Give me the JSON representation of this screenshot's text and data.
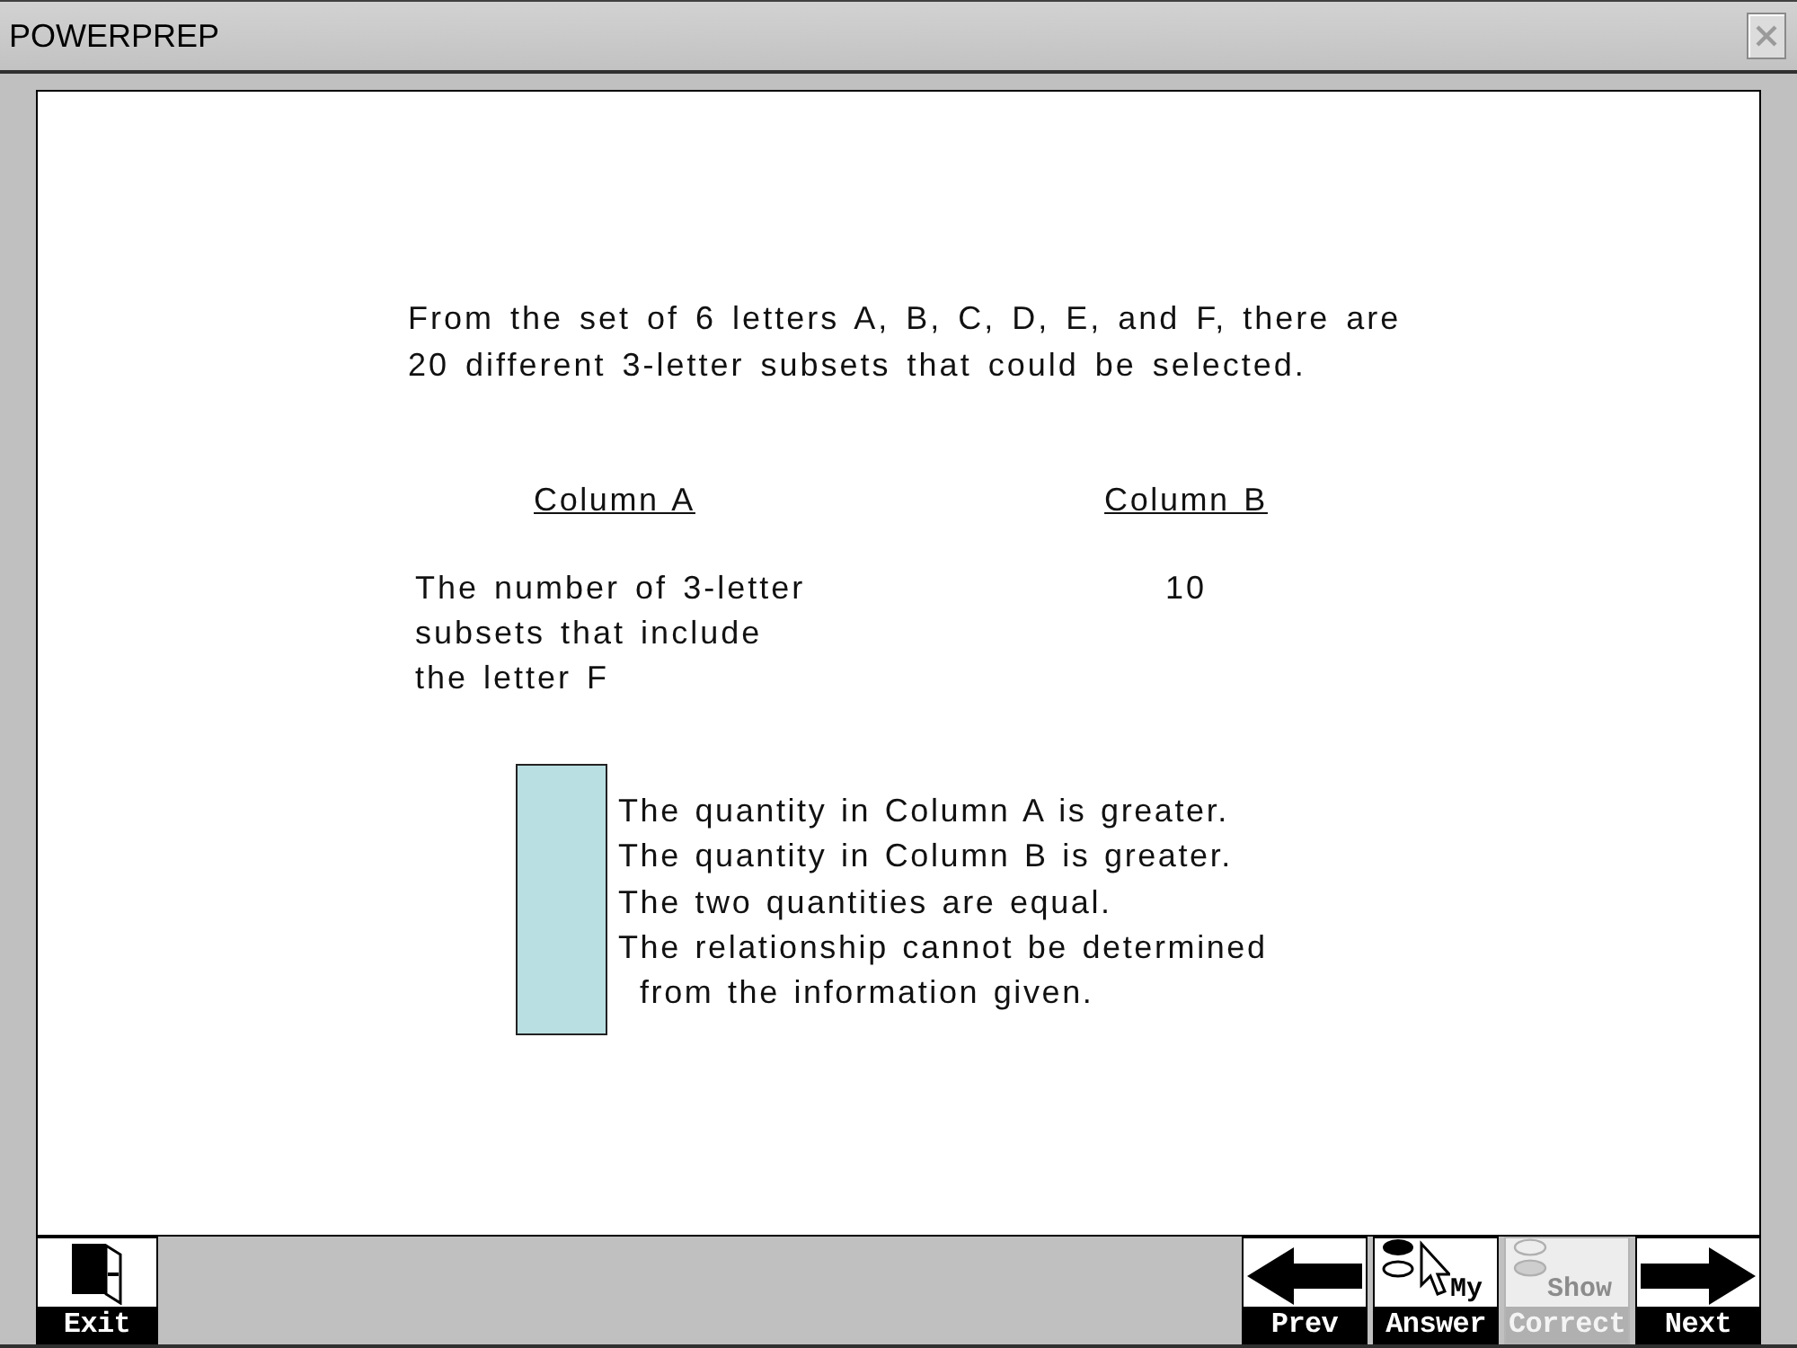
{
  "window": {
    "title": "POWERPREP"
  },
  "question": {
    "stem": "From the set of 6 letters A, B, C, D, E, and F, there are\n20 different 3-letter subsets that could be selected.",
    "column_a": {
      "heading": "Column A",
      "quantity": "The number of 3-letter\nsubsets that include\nthe letter F"
    },
    "column_b": {
      "heading": "Column B",
      "quantity": "10"
    },
    "answer_choices": [
      "The quantity in Column A is greater.",
      "The quantity in Column B is greater.",
      "The two quantities are equal.",
      "The relationship cannot be determined\nfrom the information given."
    ]
  },
  "toolbar": {
    "buttons": [
      {
        "kind": "exit",
        "label": "Exit",
        "disabled": false
      },
      {
        "kind": "prev",
        "label": "Prev",
        "disabled": false
      },
      {
        "kind": "my_answer",
        "top_label": "My",
        "label": "Answer",
        "disabled": false
      },
      {
        "kind": "show_correct",
        "top_label": "Show",
        "label": "Correct",
        "disabled": true
      },
      {
        "kind": "next",
        "label": "Next",
        "disabled": false
      }
    ]
  }
}
